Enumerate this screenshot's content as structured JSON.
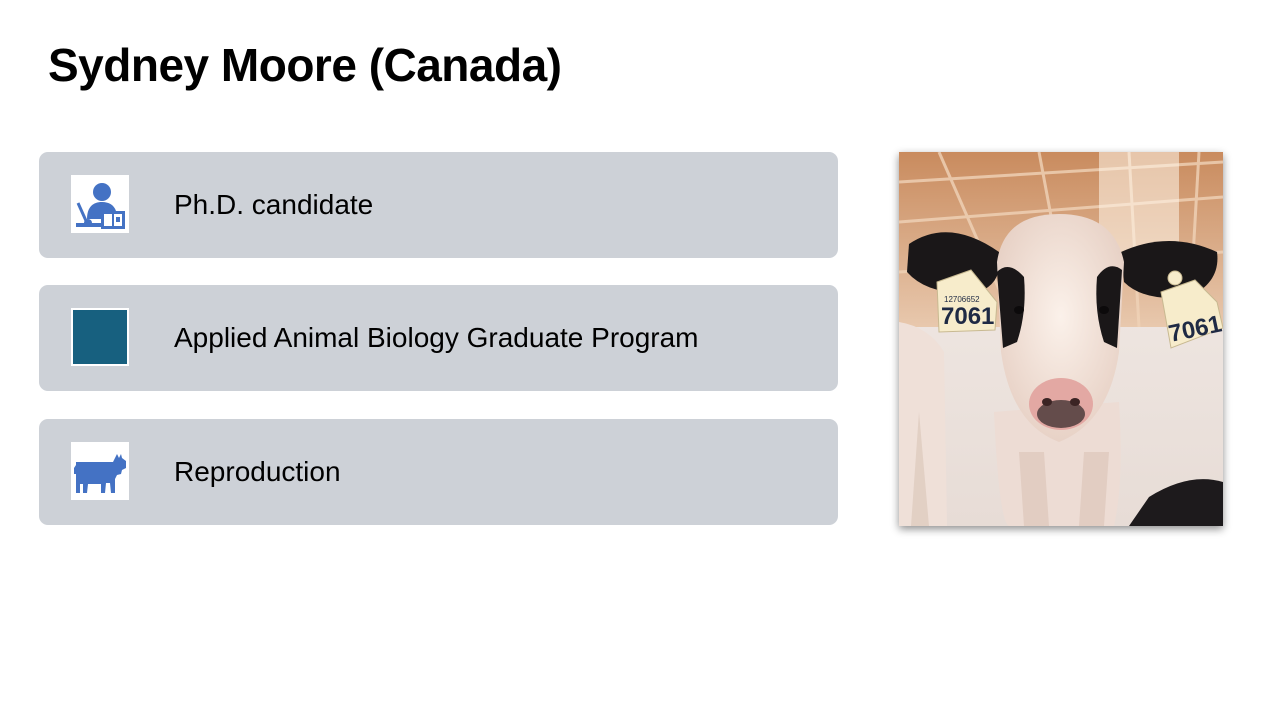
{
  "slide": {
    "title": "Sydney Moore (Canada)"
  },
  "cards": [
    {
      "label": "Ph.D. candidate",
      "icon": "teacher-icon"
    },
    {
      "label": "Applied Animal Biology Graduate Program",
      "icon": "program-square-icon"
    },
    {
      "label": "Reproduction",
      "icon": "cow-icon"
    }
  ],
  "photo": {
    "ear_tag_number": "7061",
    "ear_tag_serial": "12706652"
  },
  "colors": {
    "card_bg": "#cdd1d7",
    "icon_blue": "#4472c4",
    "program_square": "#17607f"
  }
}
